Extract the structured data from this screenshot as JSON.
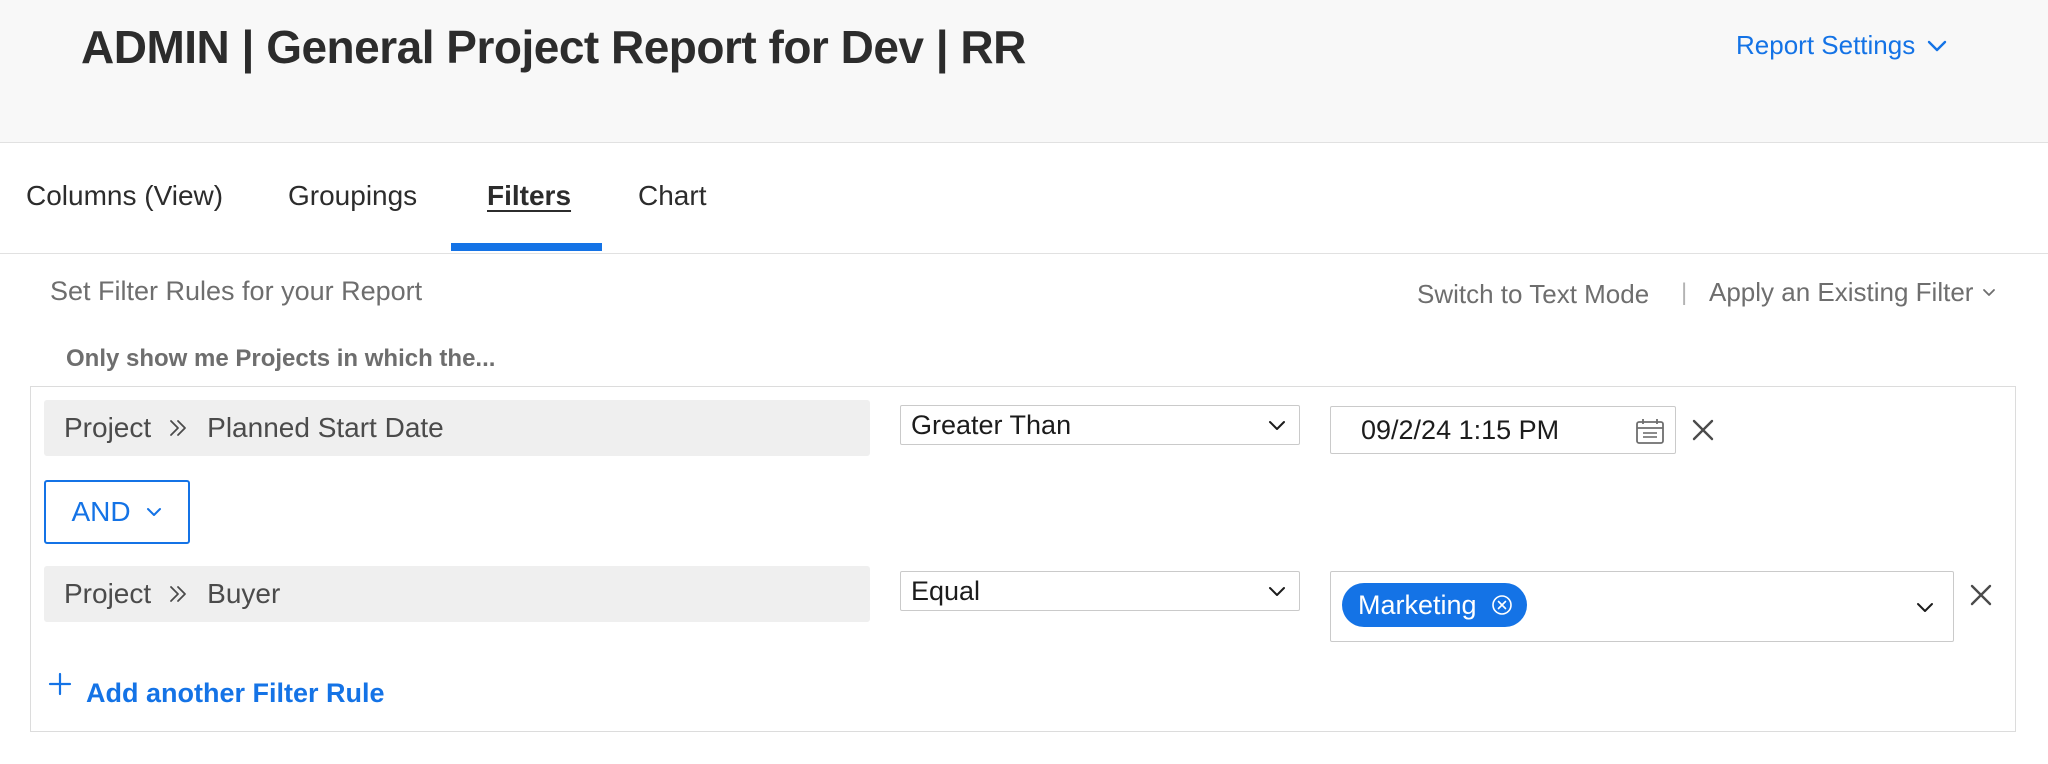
{
  "header": {
    "title": "ADMIN | General Project Report for Dev | RR",
    "settings_label": "Report Settings"
  },
  "tabs": [
    {
      "label": "Columns (View)",
      "active": false
    },
    {
      "label": "Groupings",
      "active": false
    },
    {
      "label": "Filters",
      "active": true
    },
    {
      "label": "Chart",
      "active": false
    }
  ],
  "filters": {
    "heading": "Set Filter Rules for your Report",
    "switch_mode_label": "Switch to Text Mode",
    "separator": "|",
    "apply_existing_label": "Apply an Existing Filter",
    "intro": "Only show me Projects in which the...",
    "rules": [
      {
        "object": "Project",
        "field": "Planned Start Date",
        "operator": "Greater Than",
        "value": "09/2/24 1:15 PM"
      },
      {
        "object": "Project",
        "field": "Buyer",
        "operator": "Equal",
        "tags": [
          "Marketing"
        ]
      }
    ],
    "conjunction": "AND",
    "add_rule_label": "Add another Filter Rule"
  },
  "colors": {
    "accent": "#1473e6",
    "header_bg": "#f8f8f8",
    "pill_bg": "#efefef"
  }
}
